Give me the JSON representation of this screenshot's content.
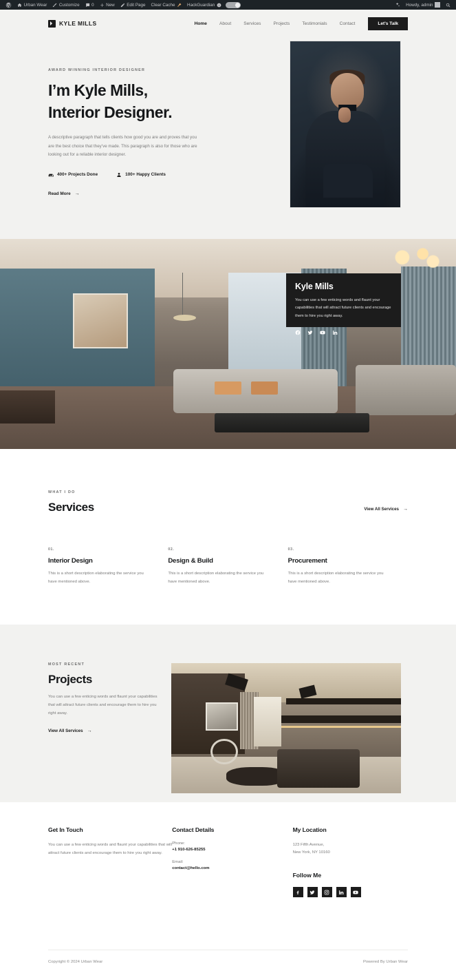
{
  "adminbar": {
    "wp_logo": "wordpress-icon",
    "site_name": "Urban Wear",
    "customize": "Customize",
    "comments_count": "0",
    "new": "New",
    "edit_page": "Edit Page",
    "clear_cache": "Clear Cache",
    "hackguardian": "HackGuardian",
    "howdy": "Howdy, admin"
  },
  "header": {
    "brand": "KYLE MILLS",
    "nav": [
      {
        "label": "Home",
        "active": true
      },
      {
        "label": "About",
        "active": false
      },
      {
        "label": "Services",
        "active": false
      },
      {
        "label": "Projects",
        "active": false
      },
      {
        "label": "Testimonials",
        "active": false
      },
      {
        "label": "Contact",
        "active": false
      }
    ],
    "cta": "Let's Talk"
  },
  "hero": {
    "eyebrow": "AWARD WINNING INTERIOR DESIGNER",
    "title_line1": "I’m Kyle Mills,",
    "title_line2": "Interior Designer.",
    "paragraph": "A descriptive paragraph that tells clients how good you are and proves that you are the best choice that they’ve made. This paragraph is also for those who are looking out for a reliable interior designer.",
    "stat1": "400+ Projects Done",
    "stat2": "100+ Happy Clients",
    "read_more": "Read More",
    "arrow": "→"
  },
  "banner_card": {
    "title": "Kyle Mills",
    "paragraph": "You can use a few enticing words and flaunt your capabilities that will attract future clients and encourage them to hire you right away.",
    "socials": [
      "facebook-icon",
      "twitter-icon",
      "youtube-icon",
      "linkedin-icon"
    ]
  },
  "services": {
    "eyebrow": "WHAT I DO",
    "title": "Services",
    "view_all": "View All Services",
    "arrow": "→",
    "items": [
      {
        "num": "01.",
        "name": "Interior Design",
        "desc": "This is a short description elaborating the service you have mentioned above."
      },
      {
        "num": "02.",
        "name": "Design & Build",
        "desc": "This is a short description elaborating the service you have mentioned above."
      },
      {
        "num": "03.",
        "name": "Procurement",
        "desc": "This is a short description elaborating the service you have mentioned above."
      }
    ]
  },
  "projects": {
    "eyebrow": "MOST RECENT",
    "title": "Projects",
    "desc": "You can use a few enticing words and flaunt your capabilities that will attract future clients and encourage them to hire you right away.",
    "view_all": "View All Services",
    "arrow": "→"
  },
  "footer": {
    "get_in_touch_title": "Get In Touch",
    "get_in_touch_desc": "You can use a few enticing words and flaunt your capabilities that will attract future clients and encourage them to hire you right away.",
    "contact_title": "Contact Details",
    "phone_label": "Phone:",
    "phone_value": "+1 910-626-85255",
    "email_label": "Email:",
    "email_value": "contact@hello.com",
    "location_title": "My Location",
    "address_line1": "123 Fifth Avenue,",
    "address_line2": "New York, NY 10160",
    "follow_title": "Follow Me",
    "socials": [
      "facebook-icon",
      "twitter-icon",
      "instagram-icon",
      "linkedin-icon",
      "youtube-icon"
    ],
    "copyright": "Copyright © 2024 Urban Wear",
    "powered_by": "Powered By Urban Wear"
  },
  "colors": {
    "dark": "#1c1c1c",
    "page_bg": "#f2f2f0",
    "muted": "#7b7b7b",
    "adminbar": "#1d2327"
  }
}
